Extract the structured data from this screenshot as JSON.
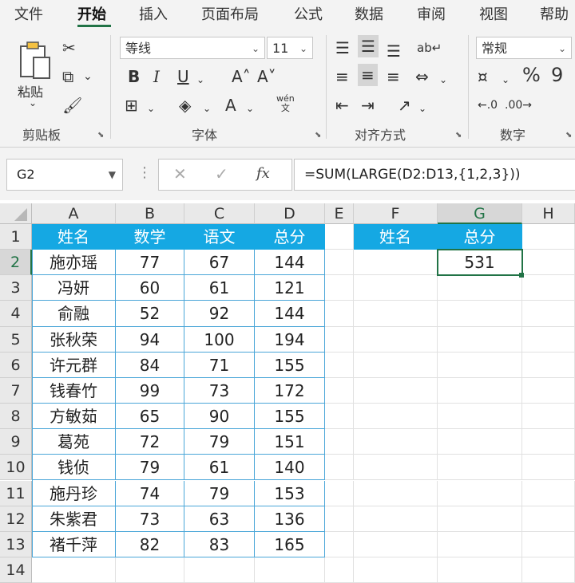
{
  "tabs": [
    {
      "label": "文件",
      "active": false
    },
    {
      "label": "开始",
      "active": true
    },
    {
      "label": "插入",
      "active": false
    },
    {
      "label": "页面布局",
      "active": false
    },
    {
      "label": "公式",
      "active": false
    },
    {
      "label": "数据",
      "active": false
    },
    {
      "label": "审阅",
      "active": false
    },
    {
      "label": "视图",
      "active": false
    },
    {
      "label": "帮助",
      "active": false
    }
  ],
  "ribbon": {
    "paste_label": "粘贴",
    "clipboard_group": "剪贴板",
    "font_group": "字体",
    "alignment_group": "对齐方式",
    "number_group": "数字",
    "font_name": "等线",
    "font_size": "11",
    "number_format": "常规",
    "bold": "B",
    "italic": "I",
    "underline": "U",
    "font_grow": "A˄",
    "font_shrink": "A˅",
    "font_color": "A",
    "phonetic": "wén\n文",
    "percent": "%",
    "comma": "9"
  },
  "formula_bar": {
    "name_box": "G2",
    "formula": "=SUM(LARGE(D2:D13,{1,2,3}))"
  },
  "accent_color": "#217346",
  "header_fill": "#15a8e3",
  "sheet": {
    "columns": [
      "A",
      "B",
      "C",
      "D",
      "E",
      "F",
      "G",
      "H"
    ],
    "selected_cell": "G2",
    "headers": [
      "姓名",
      "数学",
      "语文",
      "总分"
    ],
    "result_headers": [
      "姓名",
      "总分"
    ],
    "result_value": "531",
    "rows": [
      [
        "施亦瑶",
        "77",
        "67",
        "144"
      ],
      [
        "冯妍",
        "60",
        "61",
        "121"
      ],
      [
        "俞融",
        "52",
        "92",
        "144"
      ],
      [
        "张秋荣",
        "94",
        "100",
        "194"
      ],
      [
        "许元群",
        "84",
        "71",
        "155"
      ],
      [
        "钱春竹",
        "99",
        "73",
        "172"
      ],
      [
        "方敏茹",
        "65",
        "90",
        "155"
      ],
      [
        "葛苑",
        "72",
        "79",
        "151"
      ],
      [
        "钱侦",
        "79",
        "61",
        "140"
      ],
      [
        "施丹珍",
        "74",
        "79",
        "153"
      ],
      [
        "朱紫君",
        "73",
        "63",
        "136"
      ],
      [
        "褚千萍",
        "82",
        "83",
        "165"
      ]
    ]
  }
}
